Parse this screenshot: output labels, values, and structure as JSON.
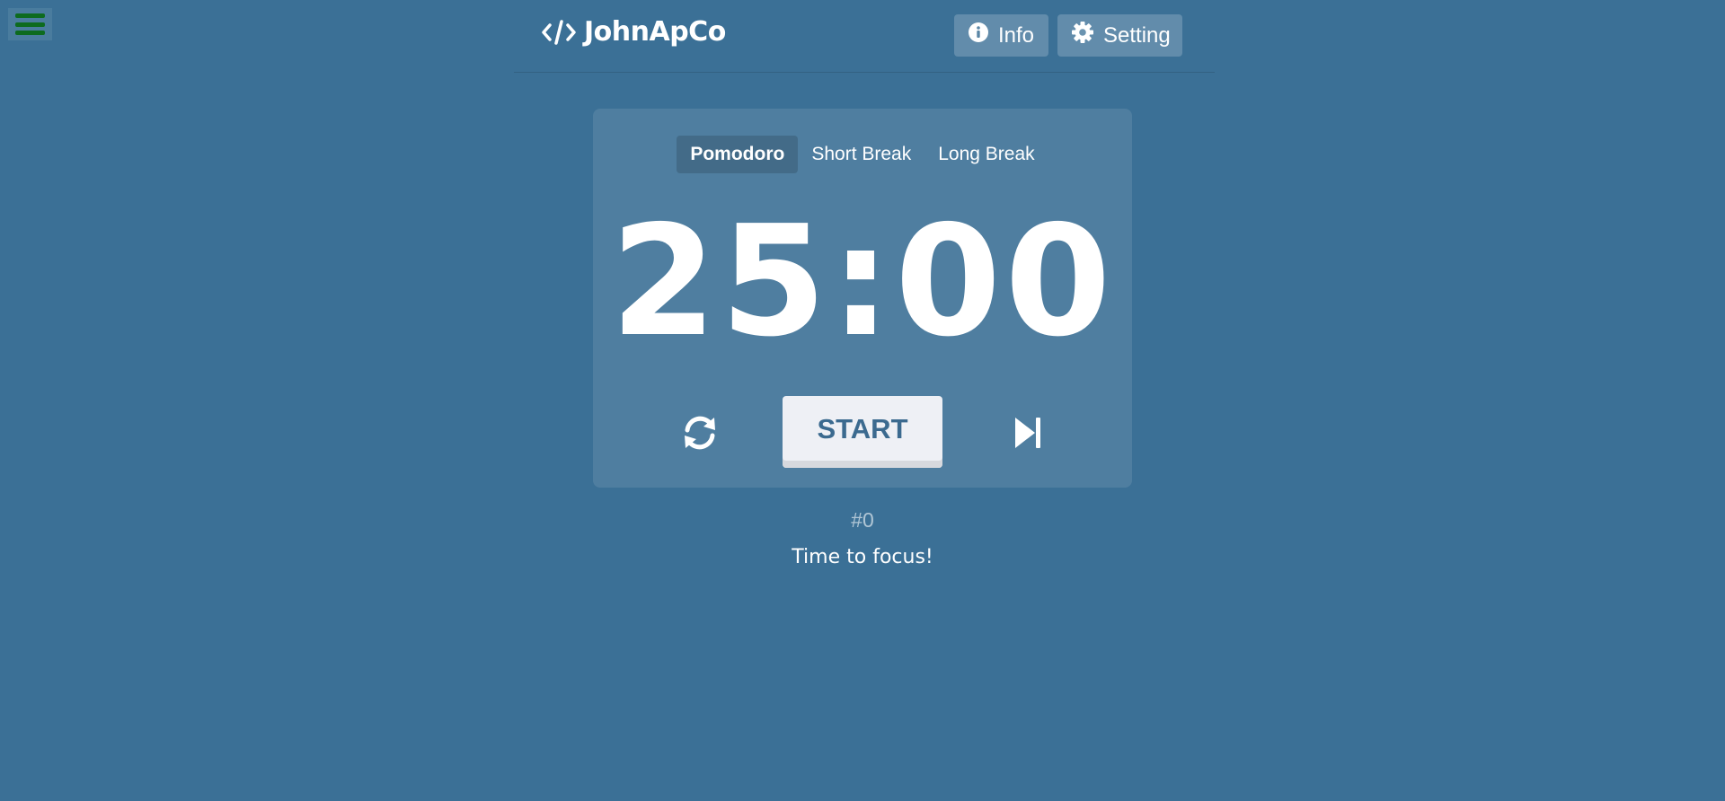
{
  "menu": {
    "icon": "hamburger-menu-icon",
    "color": "#0d6b1f"
  },
  "header": {
    "brand": "JohnApCo",
    "brand_icon": "code-icon",
    "info_label": "Info",
    "info_icon": "info-circle-icon",
    "setting_label": "Setting",
    "setting_icon": "gear-icon"
  },
  "timer": {
    "tabs": [
      {
        "label": "Pomodoro",
        "active": true
      },
      {
        "label": "Short Break",
        "active": false
      },
      {
        "label": "Long Break",
        "active": false
      }
    ],
    "time": "25:00",
    "start_label": "START",
    "reset_icon": "sync-icon",
    "skip_icon": "skip-forward-icon"
  },
  "status": {
    "counter": "#0",
    "message": "Time to focus!"
  },
  "colors": {
    "background": "#3b7096",
    "button_text": "#3b6a8f",
    "start_bg": "#eef0f5"
  }
}
